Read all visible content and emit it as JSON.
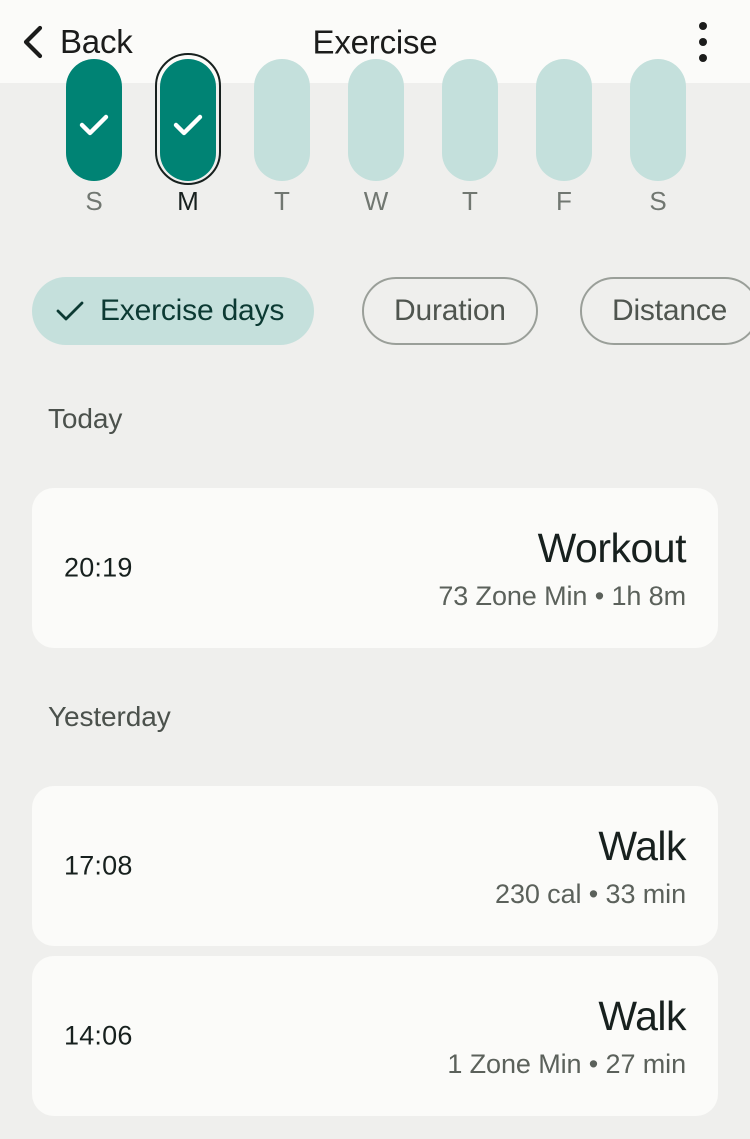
{
  "appbar": {
    "back_label": "Back",
    "title": "Exercise",
    "back_icon": "chevron-left-icon",
    "overflow_icon": "more-vertical-icon"
  },
  "week_chart": {
    "days": [
      {
        "label": "S",
        "filled": true,
        "checked": true,
        "selected": false
      },
      {
        "label": "M",
        "filled": true,
        "checked": true,
        "selected": true
      },
      {
        "label": "T",
        "filled": false,
        "checked": false,
        "selected": false
      },
      {
        "label": "W",
        "filled": false,
        "checked": false,
        "selected": false
      },
      {
        "label": "T",
        "filled": false,
        "checked": false,
        "selected": false
      },
      {
        "label": "F",
        "filled": false,
        "checked": false,
        "selected": false
      },
      {
        "label": "S",
        "filled": false,
        "checked": false,
        "selected": false
      }
    ],
    "filled_color": "#008374",
    "empty_color": "#C4E0DC",
    "selected_outline_color": "#17201E"
  },
  "chart_data": {
    "type": "bar",
    "title": "Exercise days",
    "categories": [
      "S",
      "M",
      "T",
      "W",
      "T",
      "F",
      "S"
    ],
    "values": [
      1,
      1,
      0,
      0,
      0,
      0,
      0
    ],
    "xlabel": "",
    "ylabel": "",
    "ylim": [
      0,
      1
    ],
    "grid": false,
    "legend": "none",
    "notes": "Binary exercise-day tracker: filled teal bars with checkmarks mark completed days (Sunday, Monday); pale bars mark days with no exercise. Monday is selected (outlined)."
  },
  "chips": [
    {
      "label": "Exercise days",
      "selected": true,
      "icon": "check-icon"
    },
    {
      "label": "Duration",
      "selected": false,
      "icon": null
    },
    {
      "label": "Distance",
      "selected": false,
      "icon": null
    }
  ],
  "sections": [
    {
      "header": "Today",
      "entries": [
        {
          "time": "20:19",
          "title": "Workout",
          "subtitle": "73 Zone Min • 1h 8m"
        }
      ]
    },
    {
      "header": "Yesterday",
      "entries": [
        {
          "time": "17:08",
          "title": "Walk",
          "subtitle": "230 cal • 33 min"
        },
        {
          "time": "14:06",
          "title": "Walk",
          "subtitle": "1 Zone Min • 27 min"
        }
      ]
    }
  ],
  "colors": {
    "page_background": "#EFEFED",
    "card_background": "#FBFBF9",
    "accent_teal": "#008374",
    "accent_teal_light": "#C4E0DC",
    "text_primary": "#17201E",
    "text_secondary": "#5B615B"
  }
}
